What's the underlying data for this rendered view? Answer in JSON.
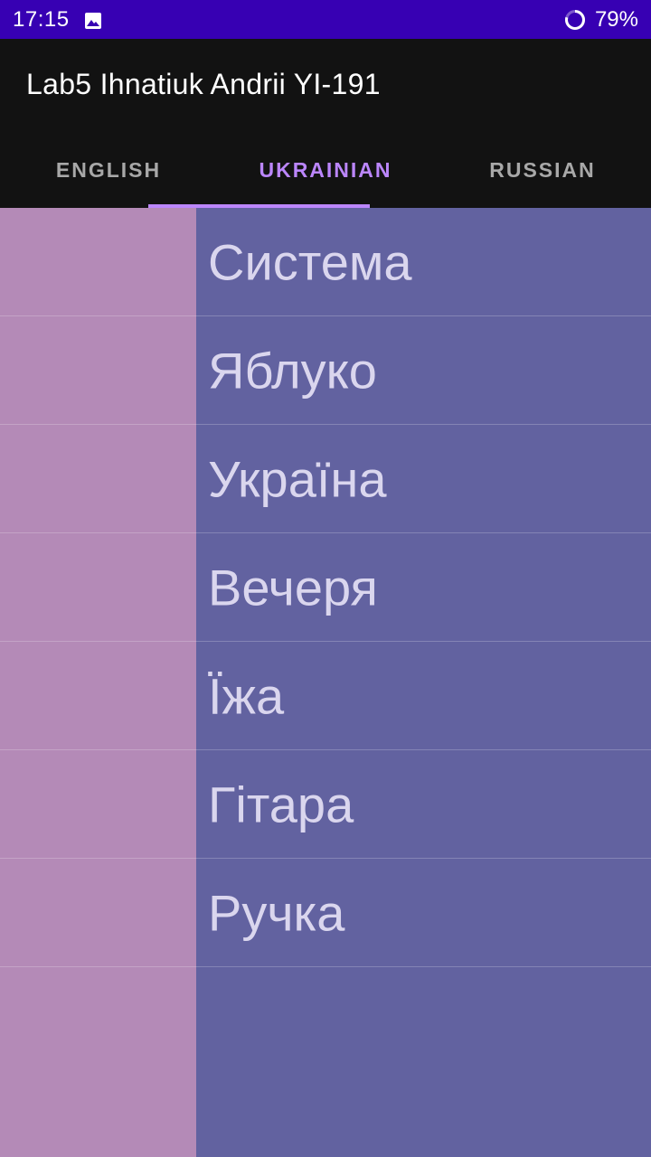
{
  "status_bar": {
    "time": "17:15",
    "battery": "79%",
    "icons": [
      "gallery-icon",
      "battery-ring-icon"
    ]
  },
  "app_bar": {
    "title": "Lab5 Ihnatiuk Andrii YI-191"
  },
  "tabs": [
    {
      "label": "ENGLISH",
      "active": false
    },
    {
      "label": "UKRAINIAN",
      "active": true
    },
    {
      "label": "RUSSIAN",
      "active": false
    }
  ],
  "words": [
    "Система",
    "Яблуко",
    "Україна",
    "Вечеря",
    "Їжа",
    "Гітара",
    "Ручка"
  ],
  "colors": {
    "status_bar": "#3700b3",
    "app_bar": "#121212",
    "accent": "#bb86fc",
    "left_panel": "#b48ab7",
    "right_panel": "#6262a0",
    "word_text": "#dad6ee"
  }
}
